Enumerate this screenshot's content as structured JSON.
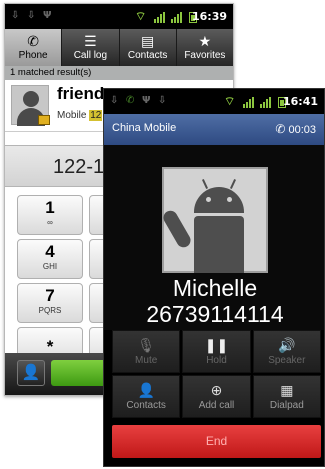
{
  "back_phone": {
    "status_time": "16:39",
    "tabs": [
      {
        "label": "Phone",
        "icon": "phone-handset-icon"
      },
      {
        "label": "Call log",
        "icon": "list-icon"
      },
      {
        "label": "Contacts",
        "icon": "contact-card-icon"
      },
      {
        "label": "Favorites",
        "icon": "star-icon"
      }
    ],
    "matched_text": "1 matched result(s)",
    "contact_name": "friend",
    "contact_type": "Mobile",
    "contact_number_highlight": "12",
    "dialed_number": "122-1",
    "keys": [
      {
        "digit": "1",
        "letters": "∞"
      },
      {
        "digit": "4",
        "letters": "GHI"
      },
      {
        "digit": "7",
        "letters": "PQRS"
      },
      {
        "digit": "*",
        "letters": ""
      }
    ]
  },
  "front_phone": {
    "status_time": "16:41",
    "carrier": "China Mobile",
    "call_timer": "00:03",
    "caller_name": "Michelle",
    "caller_number": "26739114114",
    "controls": [
      {
        "label": "Mute",
        "icon": "mic-muted-icon"
      },
      {
        "label": "Hold",
        "icon": "pause-icon"
      },
      {
        "label": "Speaker",
        "icon": "speaker-icon"
      },
      {
        "label": "Contacts",
        "icon": "person-icon"
      },
      {
        "label": "Add call",
        "icon": "add-call-icon"
      },
      {
        "label": "Dialpad",
        "icon": "dialpad-icon"
      }
    ],
    "end_label": "End"
  },
  "colors": {
    "carrier_bar": "#3a5a92",
    "end_button": "#d42a2a",
    "signal_green": "#8cc63f"
  }
}
